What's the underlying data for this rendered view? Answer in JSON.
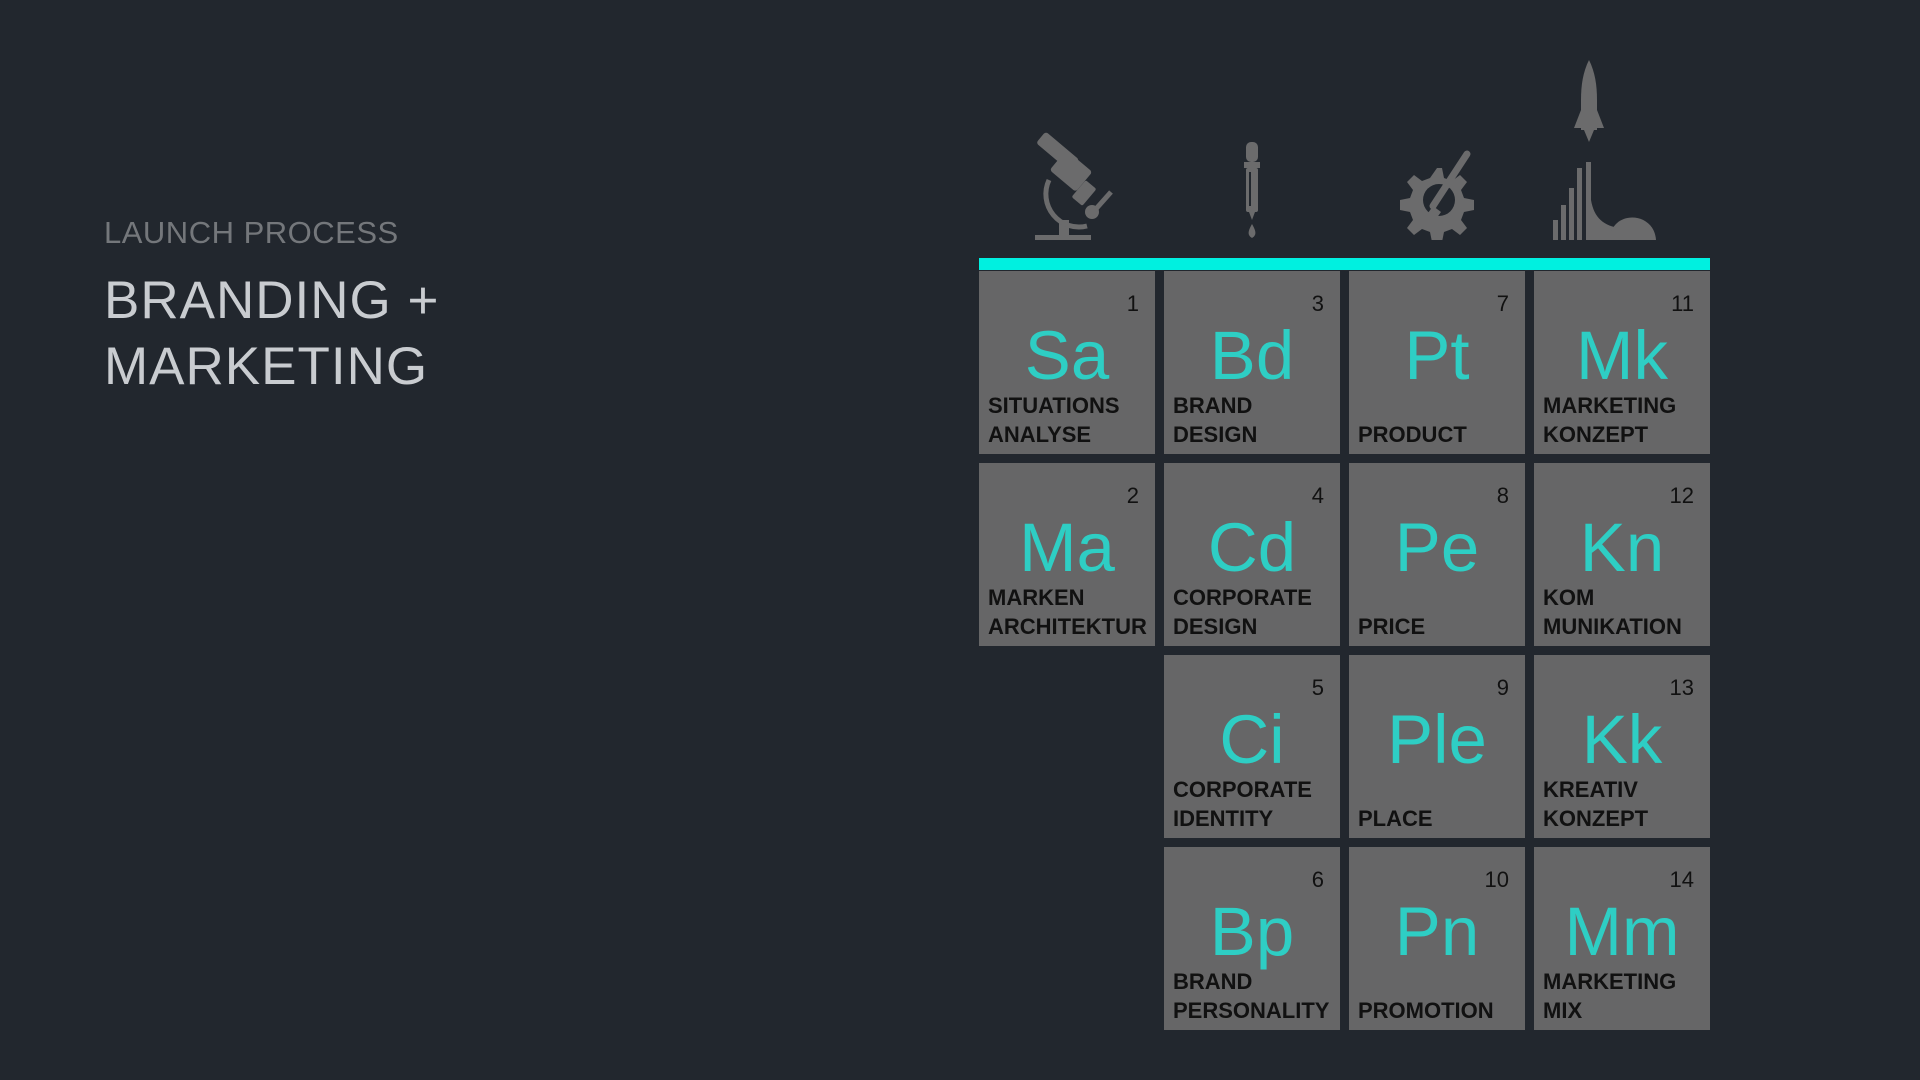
{
  "header": {
    "subtitle": "LAUNCH PROCESS",
    "title_line1": "BRANDING +",
    "title_line2": "MARKETING"
  },
  "icons": [
    {
      "name": "microscope-icon"
    },
    {
      "name": "pipette-icon"
    },
    {
      "name": "gear-brush-icon"
    },
    {
      "name": "rocket-launch-icon"
    }
  ],
  "colors": {
    "background": "#22272e",
    "accent": "#00f0e0",
    "tile": "#666667",
    "symbol": "#2ecec4",
    "icon": "#6b6b6c"
  },
  "elements": [
    {
      "num": "1",
      "sym": "Sa",
      "line1": "SITUATIONS",
      "line2": "ANALYSE",
      "col": 0,
      "row": 0
    },
    {
      "num": "2",
      "sym": "Ma",
      "line1": "MARKEN",
      "line2": "ARCHITEKTUR",
      "col": 0,
      "row": 1
    },
    {
      "num": "3",
      "sym": "Bd",
      "line1": "BRAND",
      "line2": "DESIGN",
      "col": 1,
      "row": 0
    },
    {
      "num": "4",
      "sym": "Cd",
      "line1": "CORPORATE",
      "line2": "DESIGN",
      "col": 1,
      "row": 1
    },
    {
      "num": "5",
      "sym": "Ci",
      "line1": "CORPORATE",
      "line2": "IDENTITY",
      "col": 1,
      "row": 2
    },
    {
      "num": "6",
      "sym": "Bp",
      "line1": "BRAND",
      "line2": "PERSONALITY",
      "col": 1,
      "row": 3
    },
    {
      "num": "7",
      "sym": "Pt",
      "line1": "",
      "line2": "PRODUCT",
      "col": 2,
      "row": 0
    },
    {
      "num": "8",
      "sym": "Pe",
      "line1": "",
      "line2": "PRICE",
      "col": 2,
      "row": 1
    },
    {
      "num": "9",
      "sym": "Ple",
      "line1": "",
      "line2": "PLACE",
      "col": 2,
      "row": 2
    },
    {
      "num": "10",
      "sym": "Pn",
      "line1": "",
      "line2": "PROMOTION",
      "col": 2,
      "row": 3
    },
    {
      "num": "11",
      "sym": "Mk",
      "line1": "MARKETING",
      "line2": "KONZEPT",
      "col": 3,
      "row": 0
    },
    {
      "num": "12",
      "sym": "Kn",
      "line1": "KOM",
      "line2": "MUNIKATION",
      "col": 3,
      "row": 1
    },
    {
      "num": "13",
      "sym": "Kk",
      "line1": "KREATIV",
      "line2": "KONZEPT",
      "col": 3,
      "row": 2
    },
    {
      "num": "14",
      "sym": "Mm",
      "line1": "MARKETING",
      "line2": "MIX",
      "col": 3,
      "row": 3
    }
  ]
}
